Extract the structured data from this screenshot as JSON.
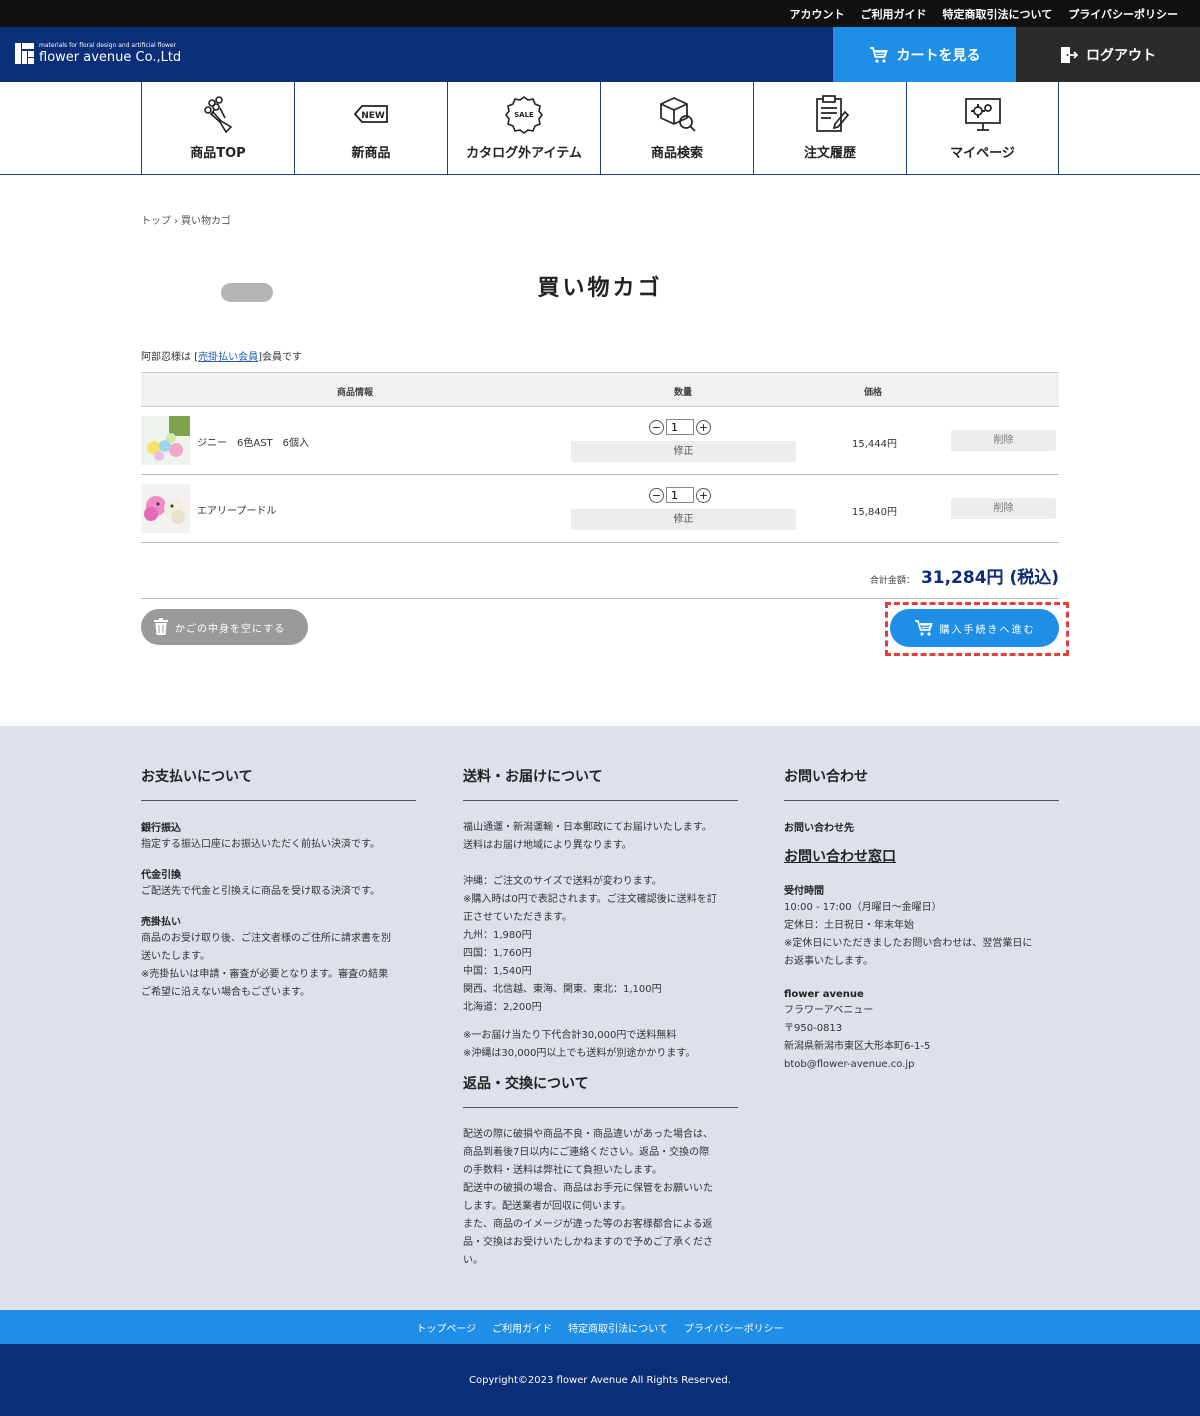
{
  "utility_nav": [
    "アカウント",
    "ご利用ガイド",
    "特定商取引法について",
    "プライバシーポリシー"
  ],
  "header": {
    "logo_small": "materials for floral design and artificial flower",
    "logo_big": "flower avenue Co.,Ltd",
    "cart_label": "カートを見る",
    "logout_label": "ログアウト"
  },
  "gnav": [
    {
      "label": "商品TOP",
      "icon": "bouquet-icon"
    },
    {
      "label": "新商品",
      "icon": "new-tag-icon"
    },
    {
      "label": "カタログ外アイテム",
      "icon": "sale-badge-icon"
    },
    {
      "label": "商品検索",
      "icon": "box-search-icon"
    },
    {
      "label": "注文履歴",
      "icon": "clipboard-icon"
    },
    {
      "label": "マイページ",
      "icon": "monitor-gear-icon"
    }
  ],
  "breadcrumb": [
    "トップ",
    "›",
    "買い物カゴ"
  ],
  "page_title": "買い物カゴ",
  "member": {
    "prefix": "阿部忍様は [",
    "type": "売掛払い会員",
    "suffix": "]会員です"
  },
  "table": {
    "headers": {
      "info": "商品情報",
      "qty": "数量",
      "price": "価格"
    },
    "rows": [
      {
        "name": "ジニー　6色AST　6個入",
        "qty": "1",
        "fix": "修正",
        "price": "15,444円",
        "delete": "削除"
      },
      {
        "name": "エアリープードル",
        "qty": "1",
        "fix": "修正",
        "price": "15,840円",
        "delete": "削除"
      }
    ]
  },
  "total": {
    "label": "合計金額：",
    "value": "31,284円 (税込)"
  },
  "buttons": {
    "empty": "かごの中身を空にする",
    "checkout": "購入手続きへ進む"
  },
  "footer": {
    "payment": {
      "title": "お支払いについて",
      "items": [
        {
          "h": "銀行振込",
          "t": "指定する振込口座にお振込いただく前払い決済です。"
        },
        {
          "h": "代金引換",
          "t": "ご配送先で代金と引換えに商品を受け取る決済です。"
        },
        {
          "h": "売掛払い",
          "t": "商品のお受け取り後、ご注文者様のご住所に請求書を別\n送いたします。\n※売掛払いは申請・審査が必要となります。審査の結果\nご希望に沿えない場合もございます。"
        }
      ]
    },
    "shipping": {
      "title": "送料・お届けについて",
      "p1": "福山通運・新潟運輸・日本郵政にてお届けいたします。\n送料はお届け地域により異なります。",
      "p2": "沖縄：ご注文のサイズで送料が変わります。\n※購入時は0円で表記されます。ご注文確認後に送料を訂\n正させていただきます。\n九州：1,980円\n四国：1,760円\n中国：1,540円\n関西、北信越、東海、関東、東北：1,100円\n北海道：2,200円",
      "p3": "※一お届け当たり下代合計30,000円で送料無料\n※沖縄は30,000円以上でも送料が別途かかります。",
      "return_title": "返品・交換について",
      "return_text": "配送の際に破損や商品不良・商品違いがあった場合は、\n商品到着後7日以内にご連絡ください。返品・交換の際\nの手数料・送料は弊社にて負担いたします。\n配送中の破損の場合、商品はお手元に保管をお願いいた\nします。配送業者が回収に伺います。\nまた、商品のイメージが違った等のお客様都合による返\n品・交換はお受けいたしかねますので予めご了承くださ\nい。"
    },
    "contact": {
      "title": "お問い合わせ",
      "sub": "お問い合わせ先",
      "link": "お問い合わせ窓口",
      "hours_title": "受付時間",
      "hours": "10:00 - 17:00（月曜日〜金曜日）\n定休日：土日祝日・年末年始\n※定休日にいただきましたお問い合わせは、翌営業日に\nお返事いたします。",
      "company": "flower avenue",
      "address": "フラワーアベニュー\n〒950-0813\n新潟県新潟市東区大形本町6-1-5\nbtob@flower-avenue.co.jp"
    }
  },
  "footer_links": [
    "トップページ",
    "ご利用ガイド",
    "特定商取引法について",
    "プライバシーポリシー"
  ],
  "copyright": "Copyright©2023 flower Avenue All Rights Reserved.",
  "colors": {
    "navy": "#0a2e77",
    "blue": "#1e8ee6",
    "dark": "#2b2b2b",
    "footer_bg": "#dde1e9"
  }
}
